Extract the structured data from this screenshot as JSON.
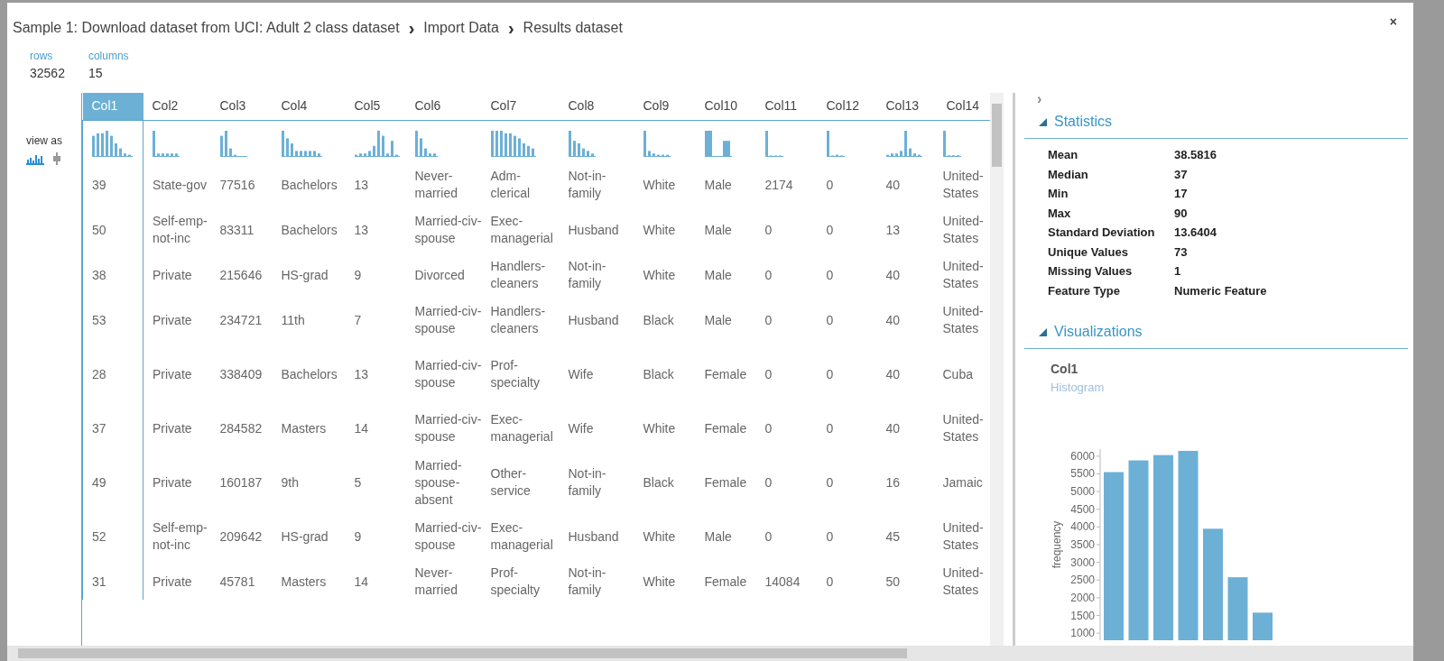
{
  "window": {
    "breadcrumb": [
      "Sample 1: Download dataset from UCI: Adult 2 class dataset",
      "Import Data",
      "Results dataset"
    ],
    "separators": [
      "›",
      "›"
    ],
    "close": "×"
  },
  "panel_toggle": "›",
  "summary": [
    {
      "label": "rows",
      "value": "32562"
    },
    {
      "label": "columns",
      "value": "15"
    }
  ],
  "view_as": {
    "label": "view as",
    "modes": [
      {
        "kind": "histogram",
        "selected": true
      },
      {
        "kind": "boxplot",
        "selected": false
      }
    ]
  },
  "table": {
    "columns": [
      {
        "name": "Col1",
        "selected": true
      },
      {
        "name": "Col2",
        "selected": false
      },
      {
        "name": "Col3",
        "selected": false
      },
      {
        "name": "Col4",
        "selected": false
      },
      {
        "name": "Col5",
        "selected": false
      },
      {
        "name": "Col6",
        "selected": false
      },
      {
        "name": "Col7",
        "selected": false
      },
      {
        "name": "Col8",
        "selected": false
      },
      {
        "name": "Col9",
        "selected": false
      },
      {
        "name": "Col10",
        "selected": false
      },
      {
        "name": "Col11",
        "selected": false
      },
      {
        "name": "Col12",
        "selected": false
      },
      {
        "name": "Col13",
        "selected": false
      },
      {
        "name": "Col14",
        "selected": false
      }
    ],
    "rows": [
      [
        "39",
        "State-gov",
        "77516",
        "Bachelors",
        "13",
        "Never-married",
        "Adm-clerical",
        "Not-in-family",
        "White",
        "Male",
        "2174",
        "0",
        "40",
        "United-States"
      ],
      [
        "50",
        "Self-emp-not-inc",
        "83311",
        "Bachelors",
        "13",
        "Married-civ-spouse",
        "Exec-managerial",
        "Husband",
        "White",
        "Male",
        "0",
        "0",
        "13",
        "United-States"
      ],
      [
        "38",
        "Private",
        "215646",
        "HS-grad",
        "9",
        "Divorced",
        "Handlers-cleaners",
        "Not-in-family",
        "White",
        "Male",
        "0",
        "0",
        "40",
        "United-States"
      ],
      [
        "53",
        "Private",
        "234721",
        "11th",
        "7",
        "Married-civ-spouse",
        "Handlers-cleaners",
        "Husband",
        "Black",
        "Male",
        "0",
        "0",
        "40",
        "United-States"
      ],
      [
        "28",
        "Private",
        "338409",
        "Bachelors",
        "13",
        "Married-civ-spouse",
        "Prof-specialty",
        "Wife",
        "Black",
        "Female",
        "0",
        "0",
        "40",
        "Cuba"
      ],
      [
        "37",
        "Private",
        "284582",
        "Masters",
        "14",
        "Married-civ-spouse",
        "Exec-managerial",
        "Wife",
        "White",
        "Female",
        "0",
        "0",
        "40",
        "United-States"
      ],
      [
        "49",
        "Private",
        "160187",
        "9th",
        "5",
        "Married-spouse-absent",
        "Other-service",
        "Not-in-family",
        "Black",
        "Female",
        "0",
        "0",
        "16",
        "Jamaic"
      ],
      [
        "52",
        "Self-emp-not-inc",
        "209642",
        "HS-grad",
        "9",
        "Married-civ-spouse",
        "Exec-managerial",
        "Husband",
        "White",
        "Male",
        "0",
        "0",
        "45",
        "United-States"
      ],
      [
        "31",
        "Private",
        "45781",
        "Masters",
        "14",
        "Never-married",
        "Prof-specialty",
        "Not-in-family",
        "White",
        "Female",
        "14084",
        "0",
        "50",
        "United-States"
      ]
    ]
  },
  "statistics": {
    "title": "Statistics",
    "expanded": true,
    "items": [
      {
        "label": "Mean",
        "value": "38.5816"
      },
      {
        "label": "Median",
        "value": "37"
      },
      {
        "label": "Min",
        "value": "17"
      },
      {
        "label": "Max",
        "value": "90"
      },
      {
        "label": "Standard Deviation",
        "value": "13.6404"
      },
      {
        "label": "Unique Values",
        "value": "73"
      },
      {
        "label": "Missing Values",
        "value": "1"
      },
      {
        "label": "Feature Type",
        "value": "Numeric Feature"
      }
    ]
  },
  "visualizations": {
    "title": "Visualizations",
    "expanded": true,
    "column": "Col1",
    "chart_kind": "Histogram",
    "chart_data": {
      "type": "bar",
      "ylabel": "frequency",
      "categories": [
        null,
        null,
        null,
        null,
        null,
        null,
        null
      ],
      "series": [
        {
          "color": "#6cb0d6",
          "values": [
            5550,
            5880,
            6030,
            6150,
            3950,
            2580,
            1580
          ]
        }
      ],
      "ylim": [
        800,
        6200
      ],
      "yticks": [
        1000,
        1500,
        2000,
        2500,
        3000,
        3500,
        4000,
        4500,
        5000,
        5500,
        6000
      ]
    }
  }
}
